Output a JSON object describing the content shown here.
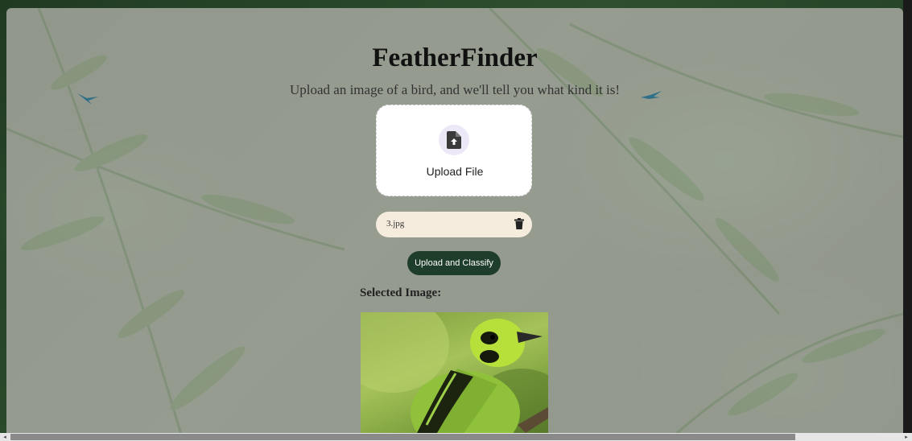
{
  "app": {
    "title": "FeatherFinder",
    "subtitle": "Upload an image of a bird, and we'll tell you what kind it is!"
  },
  "upload": {
    "label": "Upload File",
    "icon": "file-upload-icon"
  },
  "file": {
    "name": "3.jpg",
    "delete_icon": "trash-icon"
  },
  "actions": {
    "classify_label": "Upload and Classify"
  },
  "preview": {
    "label": "Selected Image:",
    "image_description": "green bird photo"
  },
  "colors": {
    "accent_button": "#1f3d2b",
    "file_row_bg": "#f5ecdd",
    "upload_icon_bg": "#ede8f7"
  },
  "scrollbar": {
    "left_arrow": "◂",
    "right_arrow": "▸"
  }
}
